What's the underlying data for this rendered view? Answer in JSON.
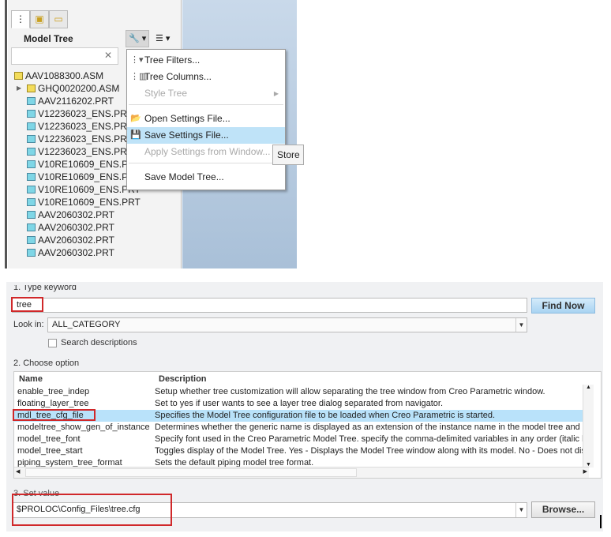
{
  "model_tree": {
    "tabs": [
      {
        "icon": "model-tree-icon"
      },
      {
        "icon": "layers-icon"
      },
      {
        "icon": "folder-icon"
      }
    ],
    "title": "Model Tree",
    "search_placeholder": "",
    "items": [
      {
        "label": "AAV1088300.ASM",
        "type": "asm",
        "level": 0
      },
      {
        "label": "GHQ0020200.ASM",
        "type": "asm",
        "level": 1,
        "expandable": true
      },
      {
        "label": "AAV2116202.PRT",
        "type": "prt",
        "level": 1
      },
      {
        "label": "V12236023_ENS.PRT",
        "type": "prt",
        "level": 1
      },
      {
        "label": "V12236023_ENS.PRT",
        "type": "prt",
        "level": 1
      },
      {
        "label": "V12236023_ENS.PRT",
        "type": "prt",
        "level": 1
      },
      {
        "label": "V12236023_ENS.PRT",
        "type": "prt",
        "level": 1
      },
      {
        "label": "V10RE10609_ENS.PRT",
        "type": "prt",
        "level": 1
      },
      {
        "label": "V10RE10609_ENS.PRT",
        "type": "prt",
        "level": 1
      },
      {
        "label": "V10RE10609_ENS.PRT",
        "type": "prt",
        "level": 1
      },
      {
        "label": "V10RE10609_ENS.PRT",
        "type": "prt",
        "level": 1
      },
      {
        "label": "AAV2060302.PRT",
        "type": "prt",
        "level": 1
      },
      {
        "label": "AAV2060302.PRT",
        "type": "prt",
        "level": 1
      },
      {
        "label": "AAV2060302.PRT",
        "type": "prt",
        "level": 1
      },
      {
        "label": "AAV2060302.PRT",
        "type": "prt",
        "level": 1
      }
    ],
    "menu": [
      {
        "label": "Tree Filters...",
        "icon": "tree-filter-icon",
        "enabled": true
      },
      {
        "label": "Tree Columns...",
        "icon": "tree-columns-icon",
        "enabled": true
      },
      {
        "label": "Style Tree",
        "enabled": false,
        "submenu": true
      },
      {
        "label": "Open Settings File...",
        "icon": "open-folder-icon",
        "enabled": true
      },
      {
        "label": "Save Settings File...",
        "icon": "save-icon",
        "enabled": true,
        "highlighted": true
      },
      {
        "label": "Apply Settings from Window...",
        "enabled": false
      },
      {
        "label": "Save Model Tree...",
        "enabled": true
      }
    ],
    "tooltip": "Store"
  },
  "options": {
    "step1_label": "1.  Type keyword",
    "keyword": "tree",
    "find_now": "Find Now",
    "look_in_label": "Look in:",
    "look_in_value": "ALL_CATEGORY",
    "search_descriptions": "Search descriptions",
    "step2_label": "2.  Choose option",
    "columns": [
      "Name",
      "Description"
    ],
    "rows": [
      {
        "name": "enable_tree_indep",
        "desc": "Setup whether tree customization will allow separating the tree window from Creo Parametric window."
      },
      {
        "name": "floating_layer_tree",
        "desc": "Set to yes if user wants to see a layer tree dialog separated from navigator."
      },
      {
        "name": "mdl_tree_cfg_file",
        "desc": "Specifies the Model Tree configuration file to be loaded when Creo Parametric is started.",
        "selected": true
      },
      {
        "name": "modeltree_show_gen_of_instance",
        "desc": "Determines whether the generic name is displayed as an extension of the instance name in the model tree and other"
      },
      {
        "name": "model_tree_font",
        "desc": "Specify font used in the Creo Parametric Model Tree. specify the comma-delimited variables in any order (italic bold,"
      },
      {
        "name": "model_tree_start",
        "desc": "Toggles display of the Model Tree. Yes - Displays the Model Tree window along with its model. No - Does not display"
      },
      {
        "name": "piping_system_tree_format",
        "desc": "Sets the default piping model tree format."
      }
    ],
    "step3_label": "3.  Set value",
    "value": "$PROLOC\\Config_Files\\tree.cfg",
    "browse": "Browse...",
    "highlight_color": "#d0282a"
  }
}
